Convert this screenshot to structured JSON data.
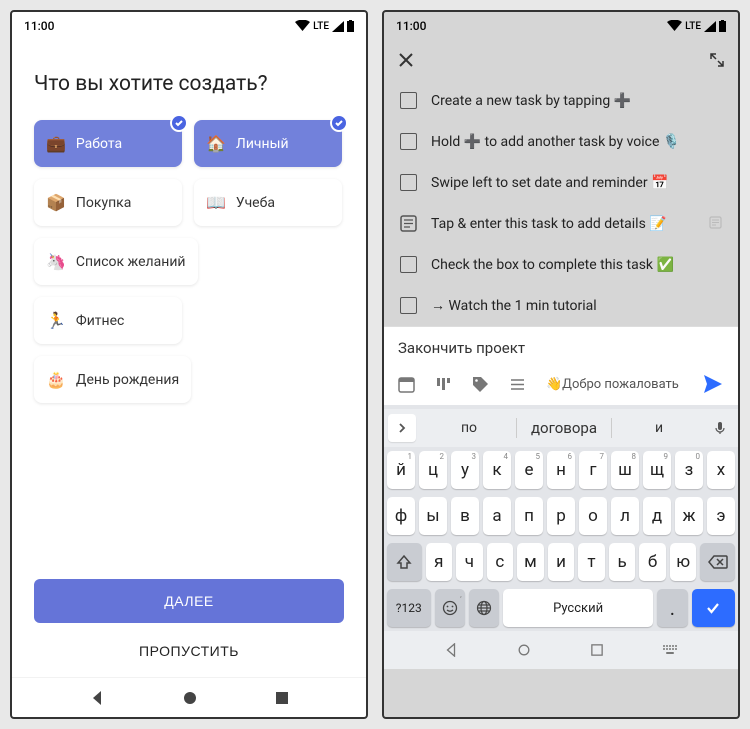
{
  "status": {
    "time": "11:00",
    "network": "LTE"
  },
  "screen1": {
    "title": "Что вы хотите создать?",
    "cards": [
      {
        "emoji": "💼",
        "label": "Работа",
        "selected": true
      },
      {
        "emoji": "🏠",
        "label": "Личный",
        "selected": true
      },
      {
        "emoji": "📦",
        "label": "Покупка",
        "selected": false
      },
      {
        "emoji": "📖",
        "label": "Учеба",
        "selected": false
      },
      {
        "emoji": "🦄",
        "label": "Список желаний",
        "selected": false
      },
      {
        "emoji": "🏃",
        "label": "Фитнес",
        "selected": false
      },
      {
        "emoji": "🎂",
        "label": "День рождения",
        "selected": false
      }
    ],
    "next": "ДАЛЕЕ",
    "skip": "ПРОПУСТИТЬ"
  },
  "screen2": {
    "tasks": [
      {
        "text": "Create a new task by tapping ➕",
        "icon": "checkbox"
      },
      {
        "text": "Hold ➕ to add another task by voice 🎙️",
        "icon": "checkbox"
      },
      {
        "text": "Swipe left to set date and reminder 📅",
        "icon": "checkbox"
      },
      {
        "text": "Tap & enter this task to add details 📝",
        "icon": "note"
      },
      {
        "text": "Check the box to complete this task ✅",
        "icon": "checkbox"
      },
      {
        "text": "→ Watch the 1 min tutorial",
        "icon": "checkbox"
      }
    ],
    "input_text": "Закончить проект",
    "chip": "👋Добро пожаловать",
    "sugg": [
      "по",
      "договора",
      "и"
    ],
    "rows": {
      "r1": [
        {
          "k": "й",
          "h": "1"
        },
        {
          "k": "ц",
          "h": "2"
        },
        {
          "k": "у",
          "h": "3"
        },
        {
          "k": "к",
          "h": "4"
        },
        {
          "k": "е",
          "h": "5"
        },
        {
          "k": "н",
          "h": "6"
        },
        {
          "k": "г",
          "h": "7"
        },
        {
          "k": "ш",
          "h": "8"
        },
        {
          "k": "щ",
          "h": "9"
        },
        {
          "k": "з",
          "h": "0"
        },
        {
          "k": "х",
          "h": ""
        }
      ],
      "r2": [
        {
          "k": "ф"
        },
        {
          "k": "ы"
        },
        {
          "k": "в"
        },
        {
          "k": "а"
        },
        {
          "k": "п"
        },
        {
          "k": "р"
        },
        {
          "k": "о"
        },
        {
          "k": "л"
        },
        {
          "k": "д"
        },
        {
          "k": "ж"
        },
        {
          "k": "э"
        }
      ],
      "r3": [
        {
          "k": "я"
        },
        {
          "k": "ч"
        },
        {
          "k": "с"
        },
        {
          "k": "м"
        },
        {
          "k": "и"
        },
        {
          "k": "т"
        },
        {
          "k": "ь"
        },
        {
          "k": "б"
        },
        {
          "k": "ю"
        }
      ]
    },
    "sym": "?123",
    "punct": ".",
    "space": "Русский"
  }
}
